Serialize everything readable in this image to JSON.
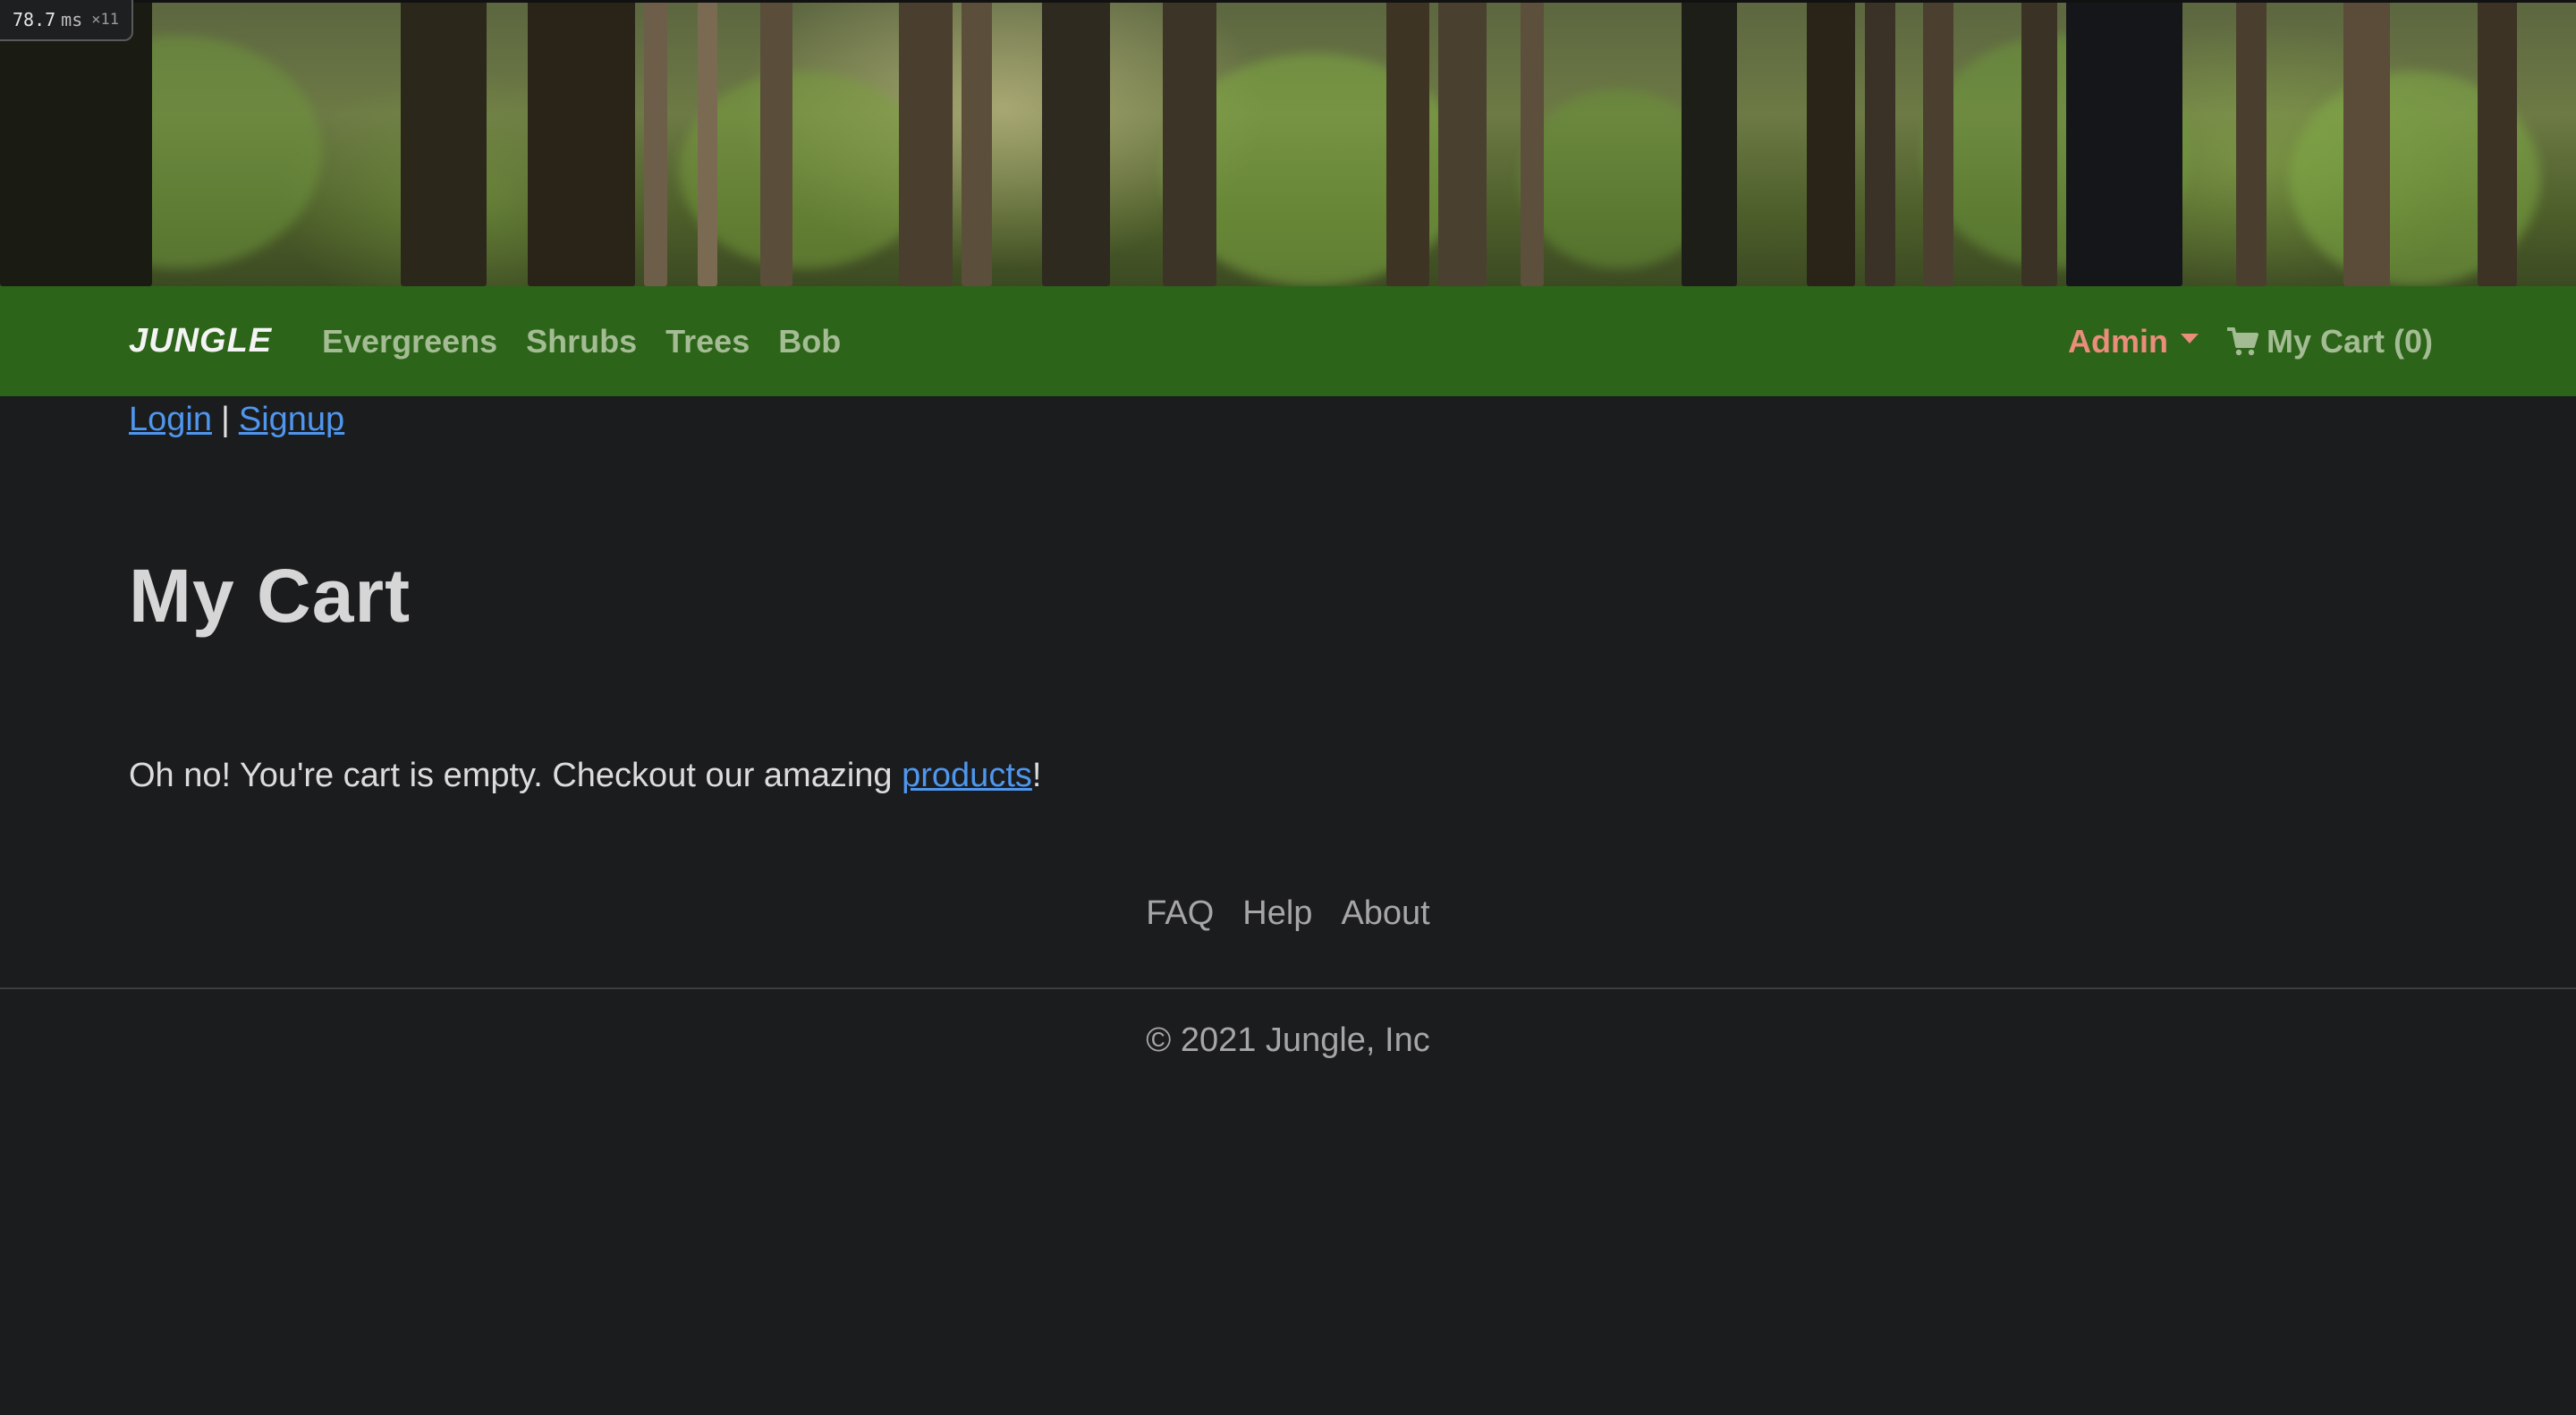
{
  "perf": {
    "value": "78.7",
    "unit": "ms",
    "multiplier": "×11"
  },
  "navbar": {
    "brand": "JUNGLE",
    "links": [
      "Evergreens",
      "Shrubs",
      "Trees",
      "Bob"
    ],
    "admin_label": "Admin",
    "cart_label": "My Cart (0)"
  },
  "auth": {
    "login": "Login",
    "separator": "|",
    "signup": "Signup"
  },
  "main": {
    "title": "My Cart",
    "empty_prefix": "Oh no! You're cart is empty. Checkout our amazing ",
    "empty_link": "products",
    "empty_suffix": "!"
  },
  "footer": {
    "links": [
      "FAQ",
      "Help",
      "About"
    ],
    "copyright": "© 2021 Jungle, Inc"
  },
  "colors": {
    "navbar_bg": "#2c6419",
    "page_bg": "#1b1c1e",
    "link": "#4f96ee",
    "admin": "#ea8d7b",
    "nav_text": "#a4bc93"
  },
  "icons": {
    "cart": "shopping-cart-icon",
    "admin_dropdown": "caret-down-icon"
  }
}
